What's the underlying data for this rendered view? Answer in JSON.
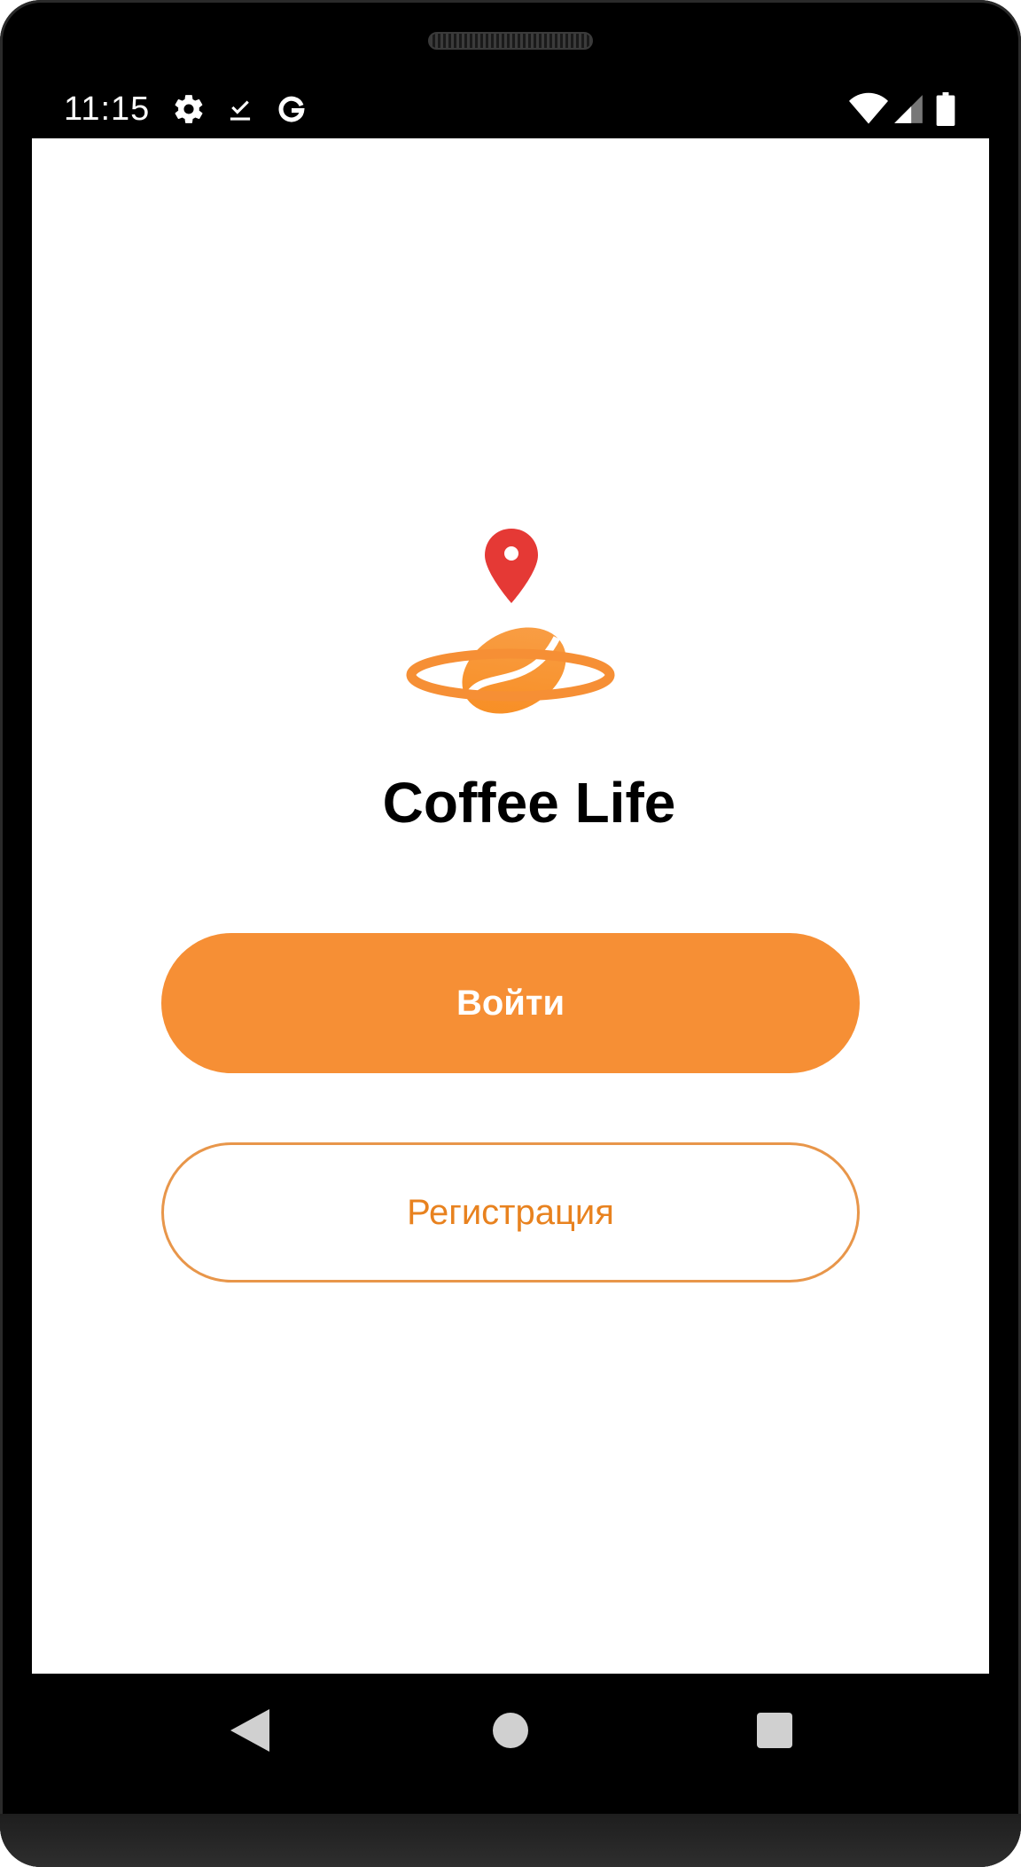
{
  "status_bar": {
    "time": "11:15",
    "left_icons": [
      "settings-icon",
      "download-done-icon",
      "google-icon"
    ],
    "right_icons": [
      "wifi-icon",
      "cellular-signal-icon",
      "battery-icon"
    ]
  },
  "app": {
    "name": "Coffee Life",
    "logo": "coffee-bean-planet-with-location-pin-logo"
  },
  "buttons": {
    "login_label": "Войти",
    "register_label": "Регистрация"
  },
  "colors": {
    "accent": "#f68f35",
    "accent_text": "#e8821f",
    "pin": "#e53935"
  },
  "nav_bar": {
    "buttons": [
      "back-icon",
      "home-icon",
      "recents-icon"
    ]
  }
}
